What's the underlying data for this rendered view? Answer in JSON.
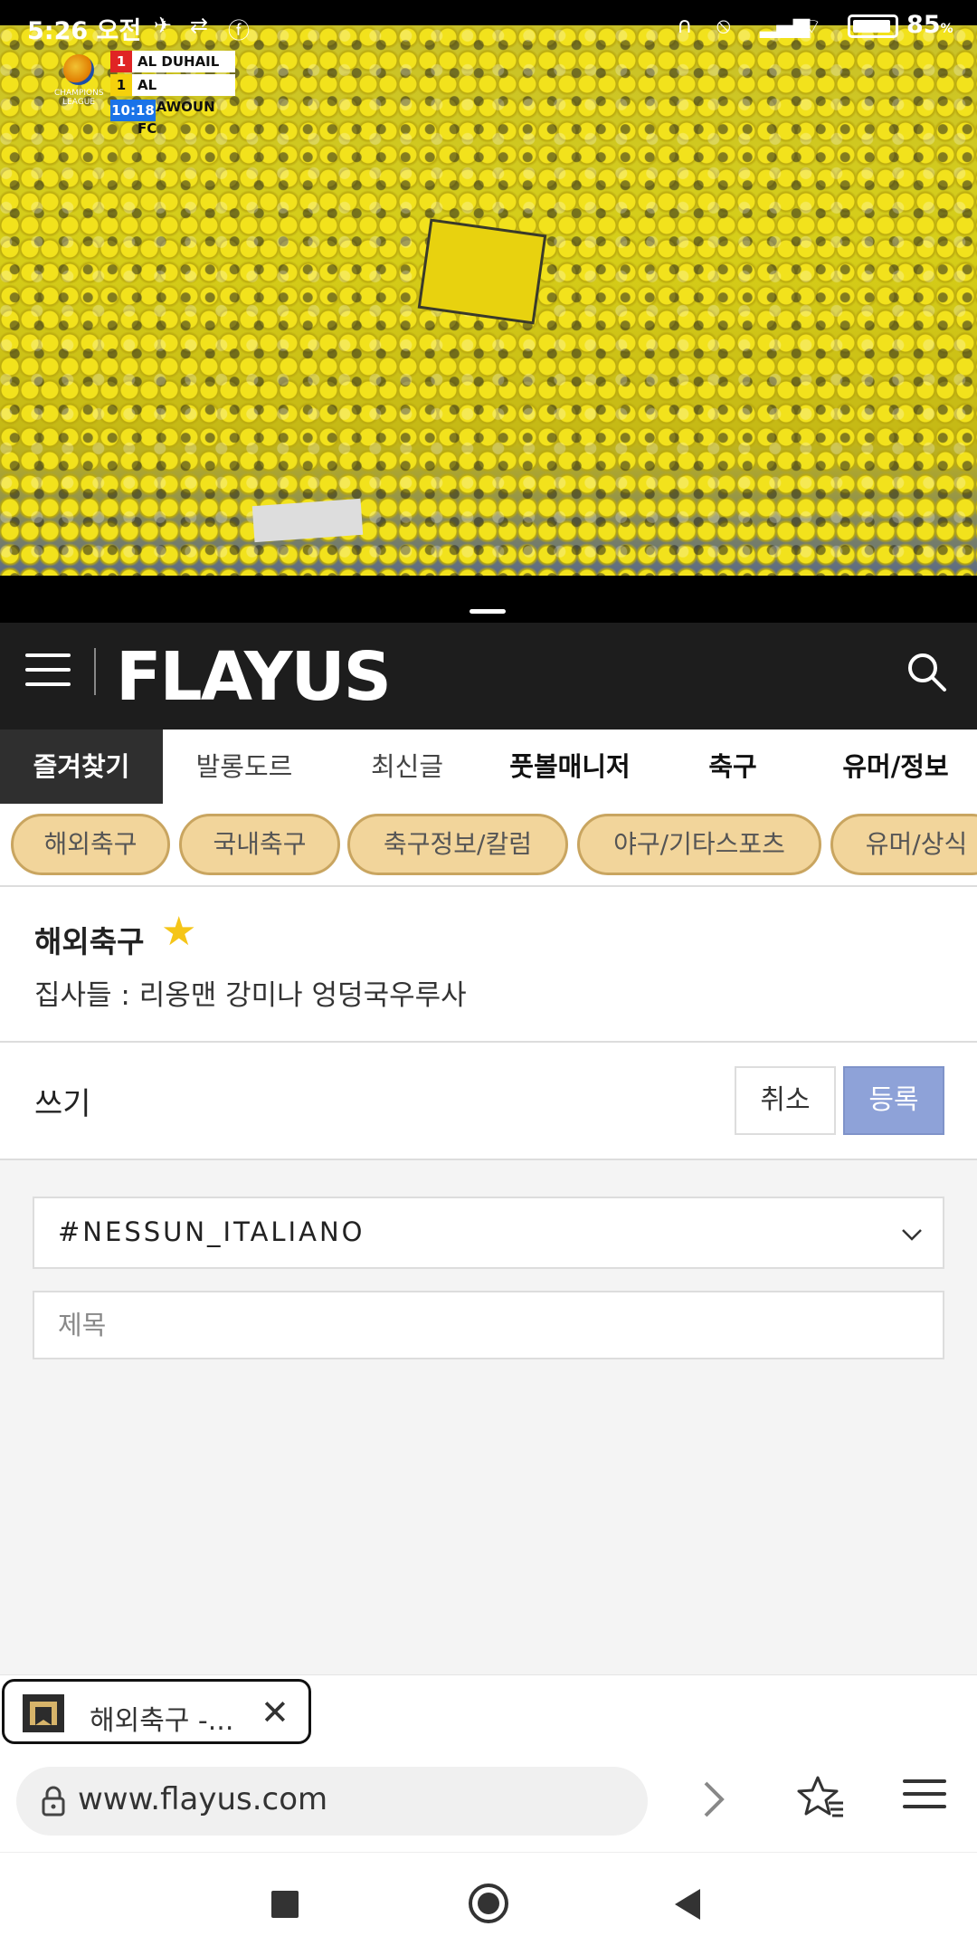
{
  "status_bar": {
    "time": "5:26 오전",
    "battery_percent": 85,
    "battery_label": "85",
    "battery_unit": "%"
  },
  "video": {
    "scoreboard": {
      "competition_logo_text": "CHAMPIONS LEAGUE",
      "team1": {
        "score": "1",
        "name": "AL DUHAIL SC"
      },
      "team2": {
        "score": "1",
        "name": "AL TAAWOUN FC"
      },
      "clock": "10:18"
    }
  },
  "site_header": {
    "logo_text": "FLAYUS"
  },
  "tabs": [
    {
      "label": "즐겨찾기",
      "active": true
    },
    {
      "label": "발롱도르",
      "active": false
    },
    {
      "label": "최신글",
      "active": false
    },
    {
      "label": "풋볼매니저",
      "active": false
    },
    {
      "label": "축구",
      "active": false
    },
    {
      "label": "유머/정보",
      "active": false
    }
  ],
  "chips": [
    {
      "label": "해외축구"
    },
    {
      "label": "국내축구"
    },
    {
      "label": "축구정보/칼럼"
    },
    {
      "label": "야구/기타스포츠"
    },
    {
      "label": "유머/상식"
    }
  ],
  "board": {
    "title": "해외축구",
    "admins": "집사들 : 리옹맨 강미나 엉덩국우루사"
  },
  "write_bar": {
    "title": "쓰기",
    "cancel_label": "취소",
    "submit_label": "등록"
  },
  "form": {
    "category_value": "#NESSUN_ITALIANO",
    "title_placeholder": "제목"
  },
  "browser": {
    "tab_title": "해외축구 -...",
    "url": "www.flayus.com"
  },
  "colors": {
    "header_bg": "#1d1d1d",
    "chip_bg": "#f2d59b",
    "chip_border": "#c9a560",
    "submit_bg": "#8ea2d8",
    "star": "#f5c518"
  }
}
